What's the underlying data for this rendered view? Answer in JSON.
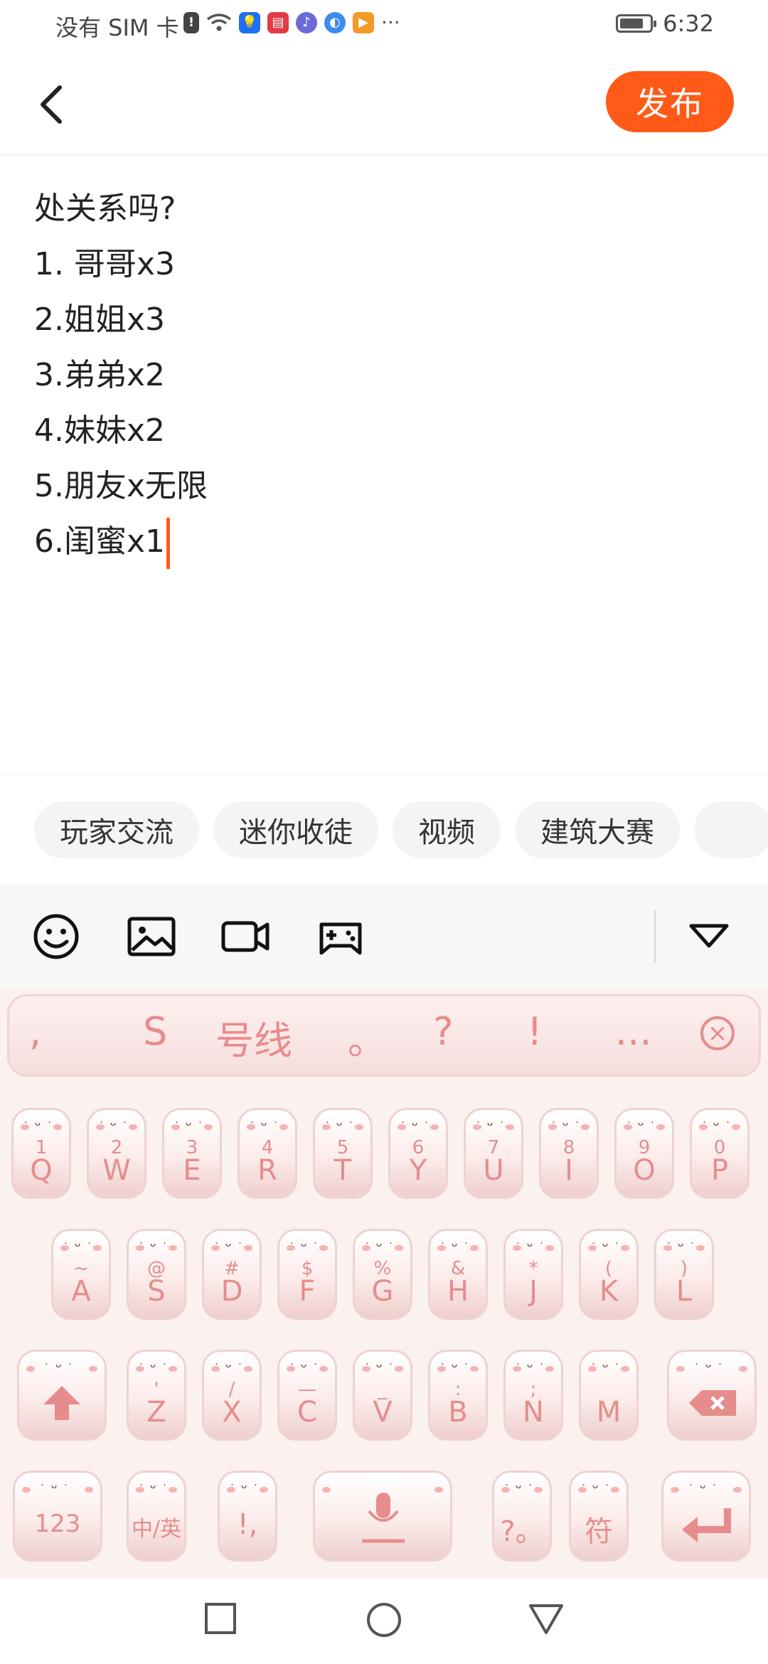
{
  "status_bar": {
    "carrier": "没有 SIM 卡",
    "time": "6:32",
    "battery_level": 0.7,
    "notification_icons": [
      "alert-icon",
      "wifi-icon",
      "bulb-app-icon",
      "book-app-icon",
      "music-app-icon",
      "browser-app-icon",
      "video-app-icon"
    ],
    "more": "···"
  },
  "header": {
    "back_icon": "chevron-left-icon",
    "publish_label": "发布",
    "accent_color": "#ff5a17"
  },
  "content": {
    "lines": [
      "处关系吗?",
      "1. 哥哥x3",
      "2.姐姐x3",
      "3.弟弟x2",
      "4.妹妹x2",
      "5.朋友x无限",
      "6.闺蜜x1"
    ]
  },
  "tags": [
    "玩家交流",
    "迷你收徒",
    "视频",
    "建筑大赛"
  ],
  "toolbar": {
    "icons": [
      "emoji-icon",
      "image-icon",
      "video-camera-icon",
      "gamepad-icon",
      "collapse-icon"
    ]
  },
  "keyboard": {
    "candidates": [
      ",",
      "S",
      "号线",
      "。",
      "?",
      "!",
      "..."
    ],
    "candidate_close_icon": "close-circle-icon",
    "row1": [
      {
        "main": "Q",
        "sub": "1"
      },
      {
        "main": "W",
        "sub": "2"
      },
      {
        "main": "E",
        "sub": "3"
      },
      {
        "main": "R",
        "sub": "4"
      },
      {
        "main": "T",
        "sub": "5"
      },
      {
        "main": "Y",
        "sub": "6"
      },
      {
        "main": "U",
        "sub": "7"
      },
      {
        "main": "I",
        "sub": "8"
      },
      {
        "main": "O",
        "sub": "9"
      },
      {
        "main": "P",
        "sub": "0"
      }
    ],
    "row2": [
      {
        "main": "A",
        "sub": "~"
      },
      {
        "main": "S",
        "sub": "@"
      },
      {
        "main": "D",
        "sub": "#"
      },
      {
        "main": "F",
        "sub": "$"
      },
      {
        "main": "G",
        "sub": "%"
      },
      {
        "main": "H",
        "sub": "&"
      },
      {
        "main": "J",
        "sub": "*"
      },
      {
        "main": "K",
        "sub": "("
      },
      {
        "main": "L",
        "sub": ")"
      }
    ],
    "row3": [
      {
        "main": "Z",
        "sub": "'"
      },
      {
        "main": "X",
        "sub": "/"
      },
      {
        "main": "C",
        "sub": "—"
      },
      {
        "main": "V",
        "sub": "_"
      },
      {
        "main": "B",
        "sub": ":"
      },
      {
        "main": "N",
        "sub": ";"
      },
      {
        "main": "M",
        "sub": ""
      }
    ],
    "shift_icon": "shift-up-arrow-icon",
    "delete_icon": "backspace-icon",
    "num_key": "123",
    "lang_key": "中/英",
    "punct_key": "!,",
    "mic_icon": "microphone-icon",
    "question_key": "?。",
    "symbol_key": "符",
    "enter_icon": "enter-arrow-icon",
    "face": "·ᴗ·"
  },
  "nav_bar": {
    "icons": [
      "recent-apps-square-icon",
      "home-circle-icon",
      "back-triangle-icon"
    ]
  }
}
